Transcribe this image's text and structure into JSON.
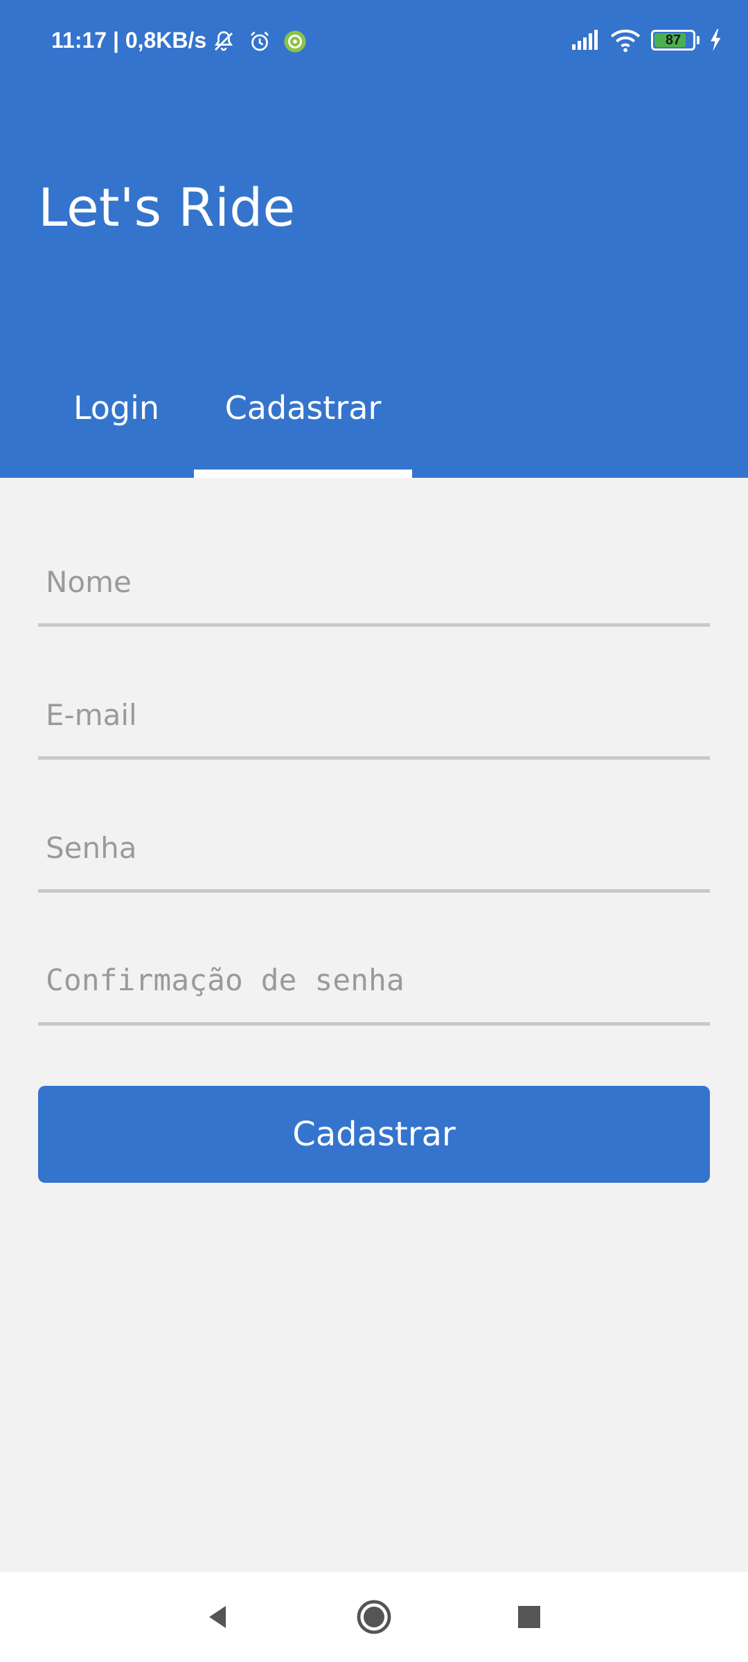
{
  "status_bar": {
    "time": "11:17 | 0,8KB/s",
    "icons_left": [
      "muted-bell-icon",
      "alarm-icon",
      "app-notification-icon"
    ],
    "icons_right": [
      "signal-icon",
      "wifi-icon",
      "battery-icon",
      "charging-icon"
    ],
    "battery_level": "87"
  },
  "header": {
    "title": "Let's Ride",
    "background": "#3574cc"
  },
  "tabs": [
    {
      "label": "Login",
      "selected": false
    },
    {
      "label": "Cadastrar",
      "selected": true
    }
  ],
  "form": {
    "fields": [
      {
        "placeholder": "Nome",
        "value": ""
      },
      {
        "placeholder": "E-mail",
        "value": ""
      },
      {
        "placeholder": "Senha",
        "value": ""
      },
      {
        "placeholder": "Confirmação de senha",
        "value": ""
      }
    ],
    "submit_label": "Cadastrar"
  },
  "nav_bar": {
    "buttons": [
      "back-icon",
      "home-icon",
      "recents-icon"
    ]
  },
  "colors": {
    "primary": "#3574cc",
    "background": "#f2f2f2",
    "underline": "#c8c8c8",
    "placeholder": "#9a9a9a"
  }
}
